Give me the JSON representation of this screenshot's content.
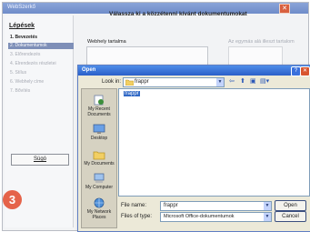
{
  "wizard": {
    "title": "WebSzerkő",
    "close_glyph": "✕",
    "steps_title": "Lépések",
    "steps": [
      "1. Bevezetés",
      "2. Dokumentumok",
      "3. Előrendezés",
      "4. Elrendezés részletei",
      "5. Stílus",
      "6. Webhely címe",
      "7. Bővítés"
    ],
    "sign_button": "Súgó",
    "main_title": "Válassza ki a közzétenni kívánt dokumentumokat",
    "web_label": "Webhely tartalma",
    "right_label": "Az egymás alá illeszt tartalom"
  },
  "dialog": {
    "title": "Open",
    "help_glyph": "?",
    "close_glyph": "✕",
    "look_in_label": "Look in:",
    "look_in_value": "frappr",
    "places": [
      "My Recent Documents",
      "Desktop",
      "My Documents",
      "My Computer",
      "My Network Places"
    ],
    "files": [
      "frappr"
    ],
    "file_name_label": "File name:",
    "file_name_value": "frappr",
    "files_of_type_label": "Files of type:",
    "files_of_type_value": "Microsoft Office-dokumentumok",
    "open_button": "Open",
    "cancel_button": "Cancel"
  },
  "step_badge": "3",
  "colors": {
    "accent": "#3169c6",
    "badge": "#e5634a",
    "titlebar": "#2b5fc9"
  }
}
